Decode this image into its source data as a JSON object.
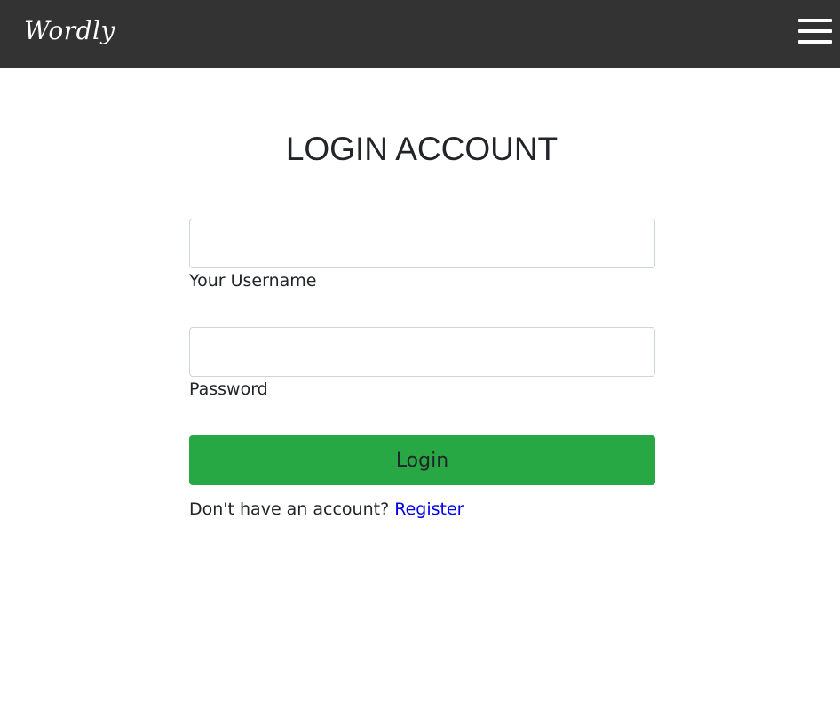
{
  "navbar": {
    "brand": "Wordly",
    "menu_icon": "hamburger-menu-icon"
  },
  "login": {
    "title": "LOGIN ACCOUNT",
    "username_label": "Your Username",
    "username_value": "",
    "password_label": "Password",
    "password_value": "",
    "submit_label": "Login",
    "no_account_text": "Don't have an account?",
    "register_link": "Register"
  },
  "colors": {
    "navbar_bg": "#333333",
    "button_bg": "#28a745",
    "link": "#0000ee"
  }
}
